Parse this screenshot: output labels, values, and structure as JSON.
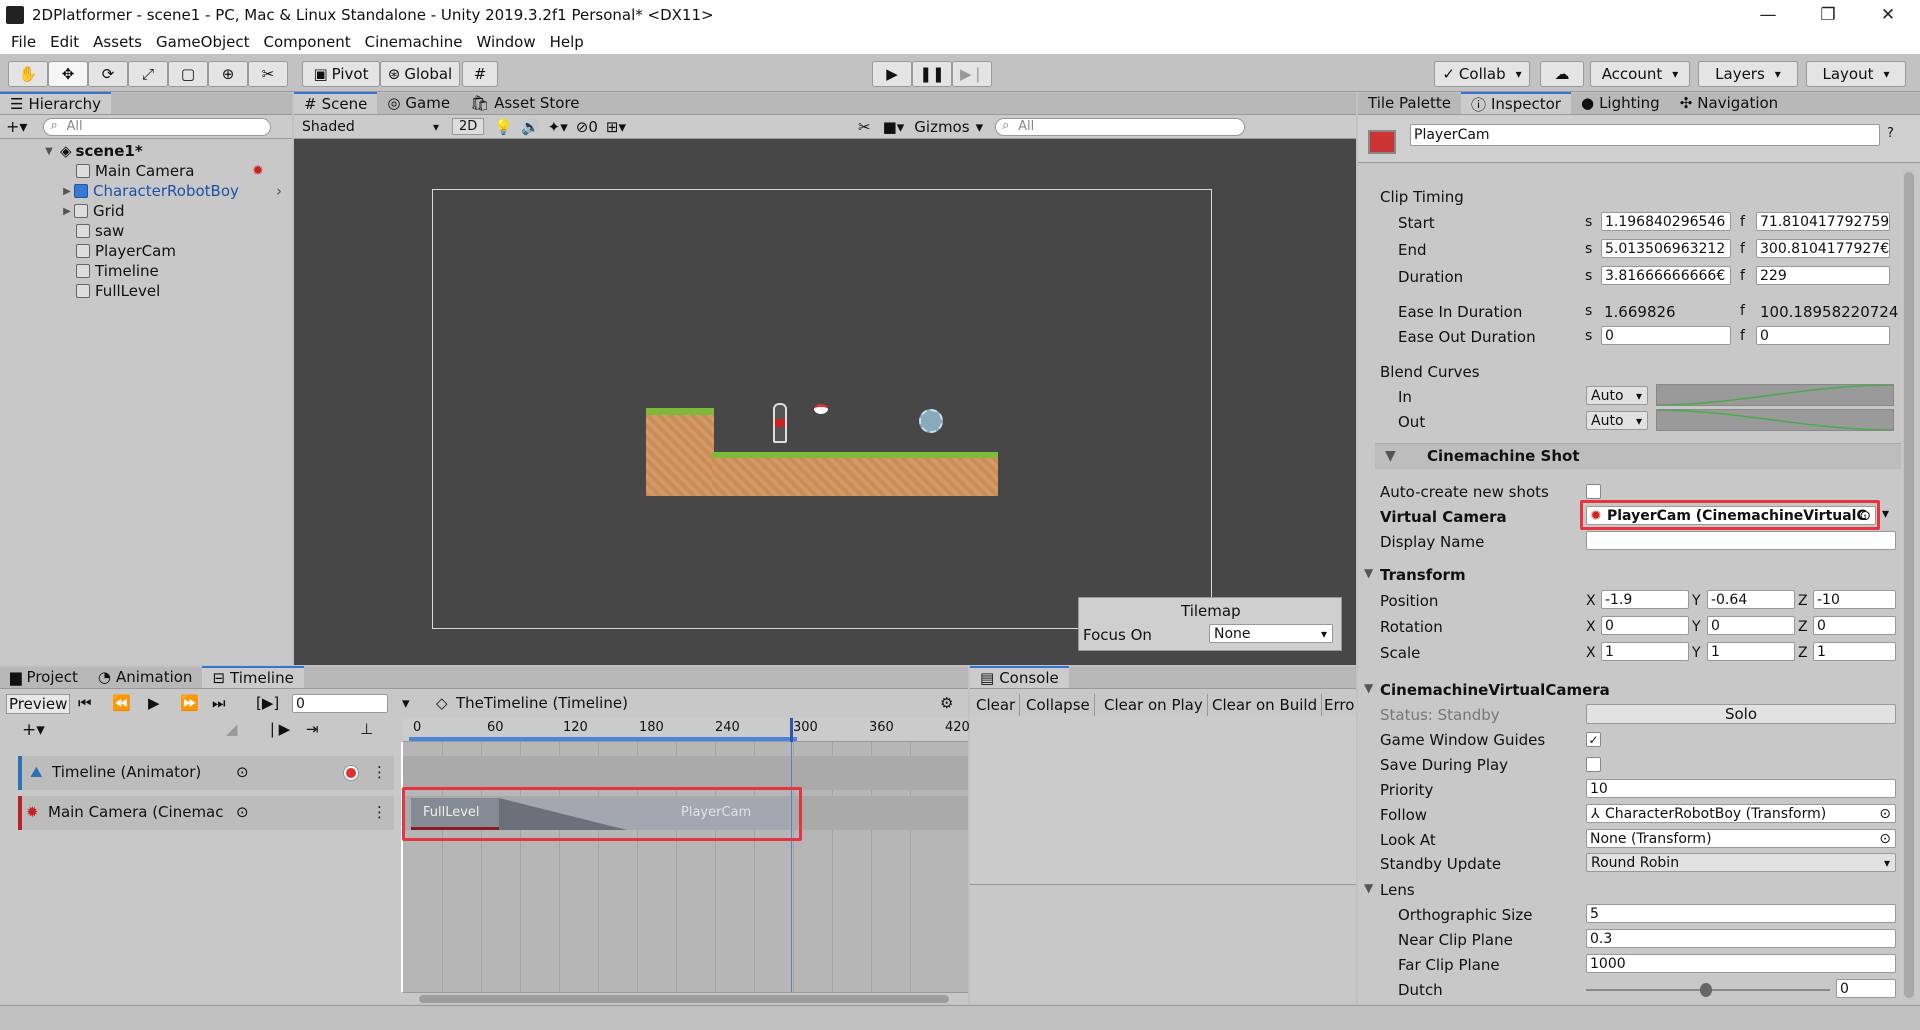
{
  "window": {
    "title": "2DPlatformer - scene1 - PC, Mac & Linux Standalone - Unity 2019.3.2f1 Personal* <DX11>"
  },
  "menu": [
    "File",
    "Edit",
    "Assets",
    "GameObject",
    "Component",
    "Cinemachine",
    "Window",
    "Help"
  ],
  "toolbar": {
    "pivot": "Pivot",
    "global": "Global",
    "collab": "Collab",
    "account": "Account",
    "layers": "Layers",
    "layout": "Layout"
  },
  "hierarchy": {
    "tab": "Hierarchy",
    "search": "All",
    "scene": "scene1*",
    "items": [
      "Main Camera",
      "CharacterRobotBoy",
      "Grid",
      "saw",
      "PlayerCam",
      "Timeline",
      "FullLevel"
    ]
  },
  "sceneTabs": {
    "scene": "Scene",
    "game": "Game",
    "store": "Asset Store"
  },
  "sceneBar": {
    "shading": "Shaded",
    "mode2d": "2D",
    "hidden": "0",
    "gizmos": "Gizmos",
    "search": "All"
  },
  "tilemap": {
    "title": "Tilemap",
    "focus_label": "Focus On",
    "focus_value": "None"
  },
  "bottomTabs": {
    "project": "Project",
    "animation": "Animation",
    "timeline": "Timeline",
    "console": "Console"
  },
  "timeline": {
    "preview": "Preview",
    "frame": "0",
    "asset": "TheTimeline (Timeline)",
    "ruler": [
      "0",
      "60",
      "120",
      "180",
      "240",
      "300",
      "360",
      "420"
    ],
    "tracks": [
      "Timeline (Animator)",
      "Main Camera (Cinemac"
    ],
    "clips": [
      "FullLevel",
      "PlayerCam"
    ]
  },
  "console": {
    "buttons": [
      "Clear",
      "Collapse",
      "Clear on Play",
      "Clear on Build",
      "Erro"
    ]
  },
  "rightTabs": {
    "tile": "Tile Palette",
    "inspector": "Inspector",
    "lighting": "Lighting",
    "nav": "Navigation"
  },
  "inspector": {
    "name": "PlayerCam",
    "clipTiming": {
      "title": "Clip Timing",
      "start": {
        "label": "Start",
        "s": "1.196840296546",
        "f": "71.810417792759"
      },
      "end": {
        "label": "End",
        "s": "5.013506963212",
        "f": "300.8104177927€"
      },
      "duration": {
        "label": "Duration",
        "s": "3.81666666666€",
        "f": "229"
      },
      "easeIn": {
        "label": "Ease In Duration",
        "s": "1.669826",
        "f": "100.18958220724"
      },
      "easeOut": {
        "label": "Ease Out Duration",
        "s": "0",
        "f": "0"
      }
    },
    "blend": {
      "title": "Blend Curves",
      "in": "In",
      "out": "Out",
      "in_val": "Auto",
      "out_val": "Auto"
    },
    "shot": {
      "title": "Cinemachine Shot",
      "auto": "Auto-create new shots",
      "vcam_label": "Virtual Camera",
      "vcam_value": "PlayerCam (CinemachineVirtualC",
      "display": "Display Name"
    },
    "transform": {
      "title": "Transform",
      "position": {
        "label": "Position",
        "x": "-1.9",
        "y": "-0.64",
        "z": "-10"
      },
      "rotation": {
        "label": "Rotation",
        "x": "0",
        "y": "0",
        "z": "0"
      },
      "scale": {
        "label": "Scale",
        "x": "1",
        "y": "1",
        "z": "1"
      }
    },
    "vcam": {
      "title": "CinemachineVirtualCamera",
      "status": "Status: Standby",
      "solo": "Solo",
      "guides": "Game Window Guides",
      "save": "Save During Play",
      "priority_label": "Priority",
      "priority": "10",
      "follow_label": "Follow",
      "follow": "CharacterRobotBoy (Transform)",
      "look_label": "Look At",
      "look": "None (Transform)",
      "standby_label": "Standby Update",
      "standby": "Round Robin"
    },
    "lens": {
      "title": "Lens",
      "ortho_label": "Orthographic Size",
      "ortho": "5",
      "near_label": "Near Clip Plane",
      "near": "0.3",
      "far_label": "Far Clip Plane",
      "far": "1000",
      "dutch_label": "Dutch",
      "dutch": "0"
    }
  },
  "axes": {
    "s": "s",
    "f": "f",
    "x": "X",
    "y": "Y",
    "z": "Z"
  }
}
